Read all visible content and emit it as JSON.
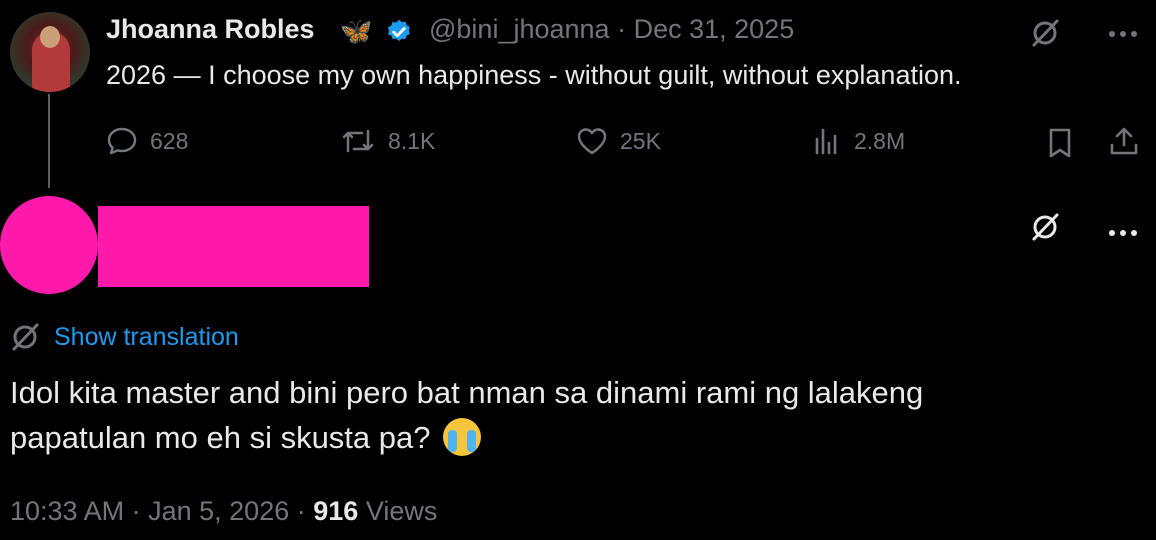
{
  "original_tweet": {
    "author_name": "Jhoanna Robles",
    "name_emoji": "🦋",
    "handle": "@bini_jhoanna",
    "separator": "·",
    "date": "Dec 31, 2025",
    "text": "2026 — I choose my own happiness - without guilt, without explanation.",
    "stats": {
      "replies": "628",
      "retweets": "8.1K",
      "likes": "25K",
      "views": "2.8M"
    }
  },
  "reply": {
    "show_translation_label": "Show translation",
    "text_line1": "Idol kita master and bini pero bat nman sa dinami rami ng lalakeng",
    "text_line2": "papatulan mo eh si skusta pa?",
    "emoji": "😭",
    "time": "10:33 AM",
    "dot": "·",
    "date": "Jan 5, 2026",
    "views_count": "916",
    "views_label": "Views"
  },
  "colors": {
    "background": "#000000",
    "text": "#e7e9ea",
    "secondary": "#71767b",
    "link": "#1d9bf0",
    "verified": "#1d9bf0",
    "redaction": "#ff1aac"
  },
  "icons": [
    "grok-icon",
    "more-icon",
    "reply-icon",
    "retweet-icon",
    "like-icon",
    "views-icon",
    "bookmark-icon",
    "share-icon",
    "verified-badge-icon",
    "translate-icon"
  ]
}
